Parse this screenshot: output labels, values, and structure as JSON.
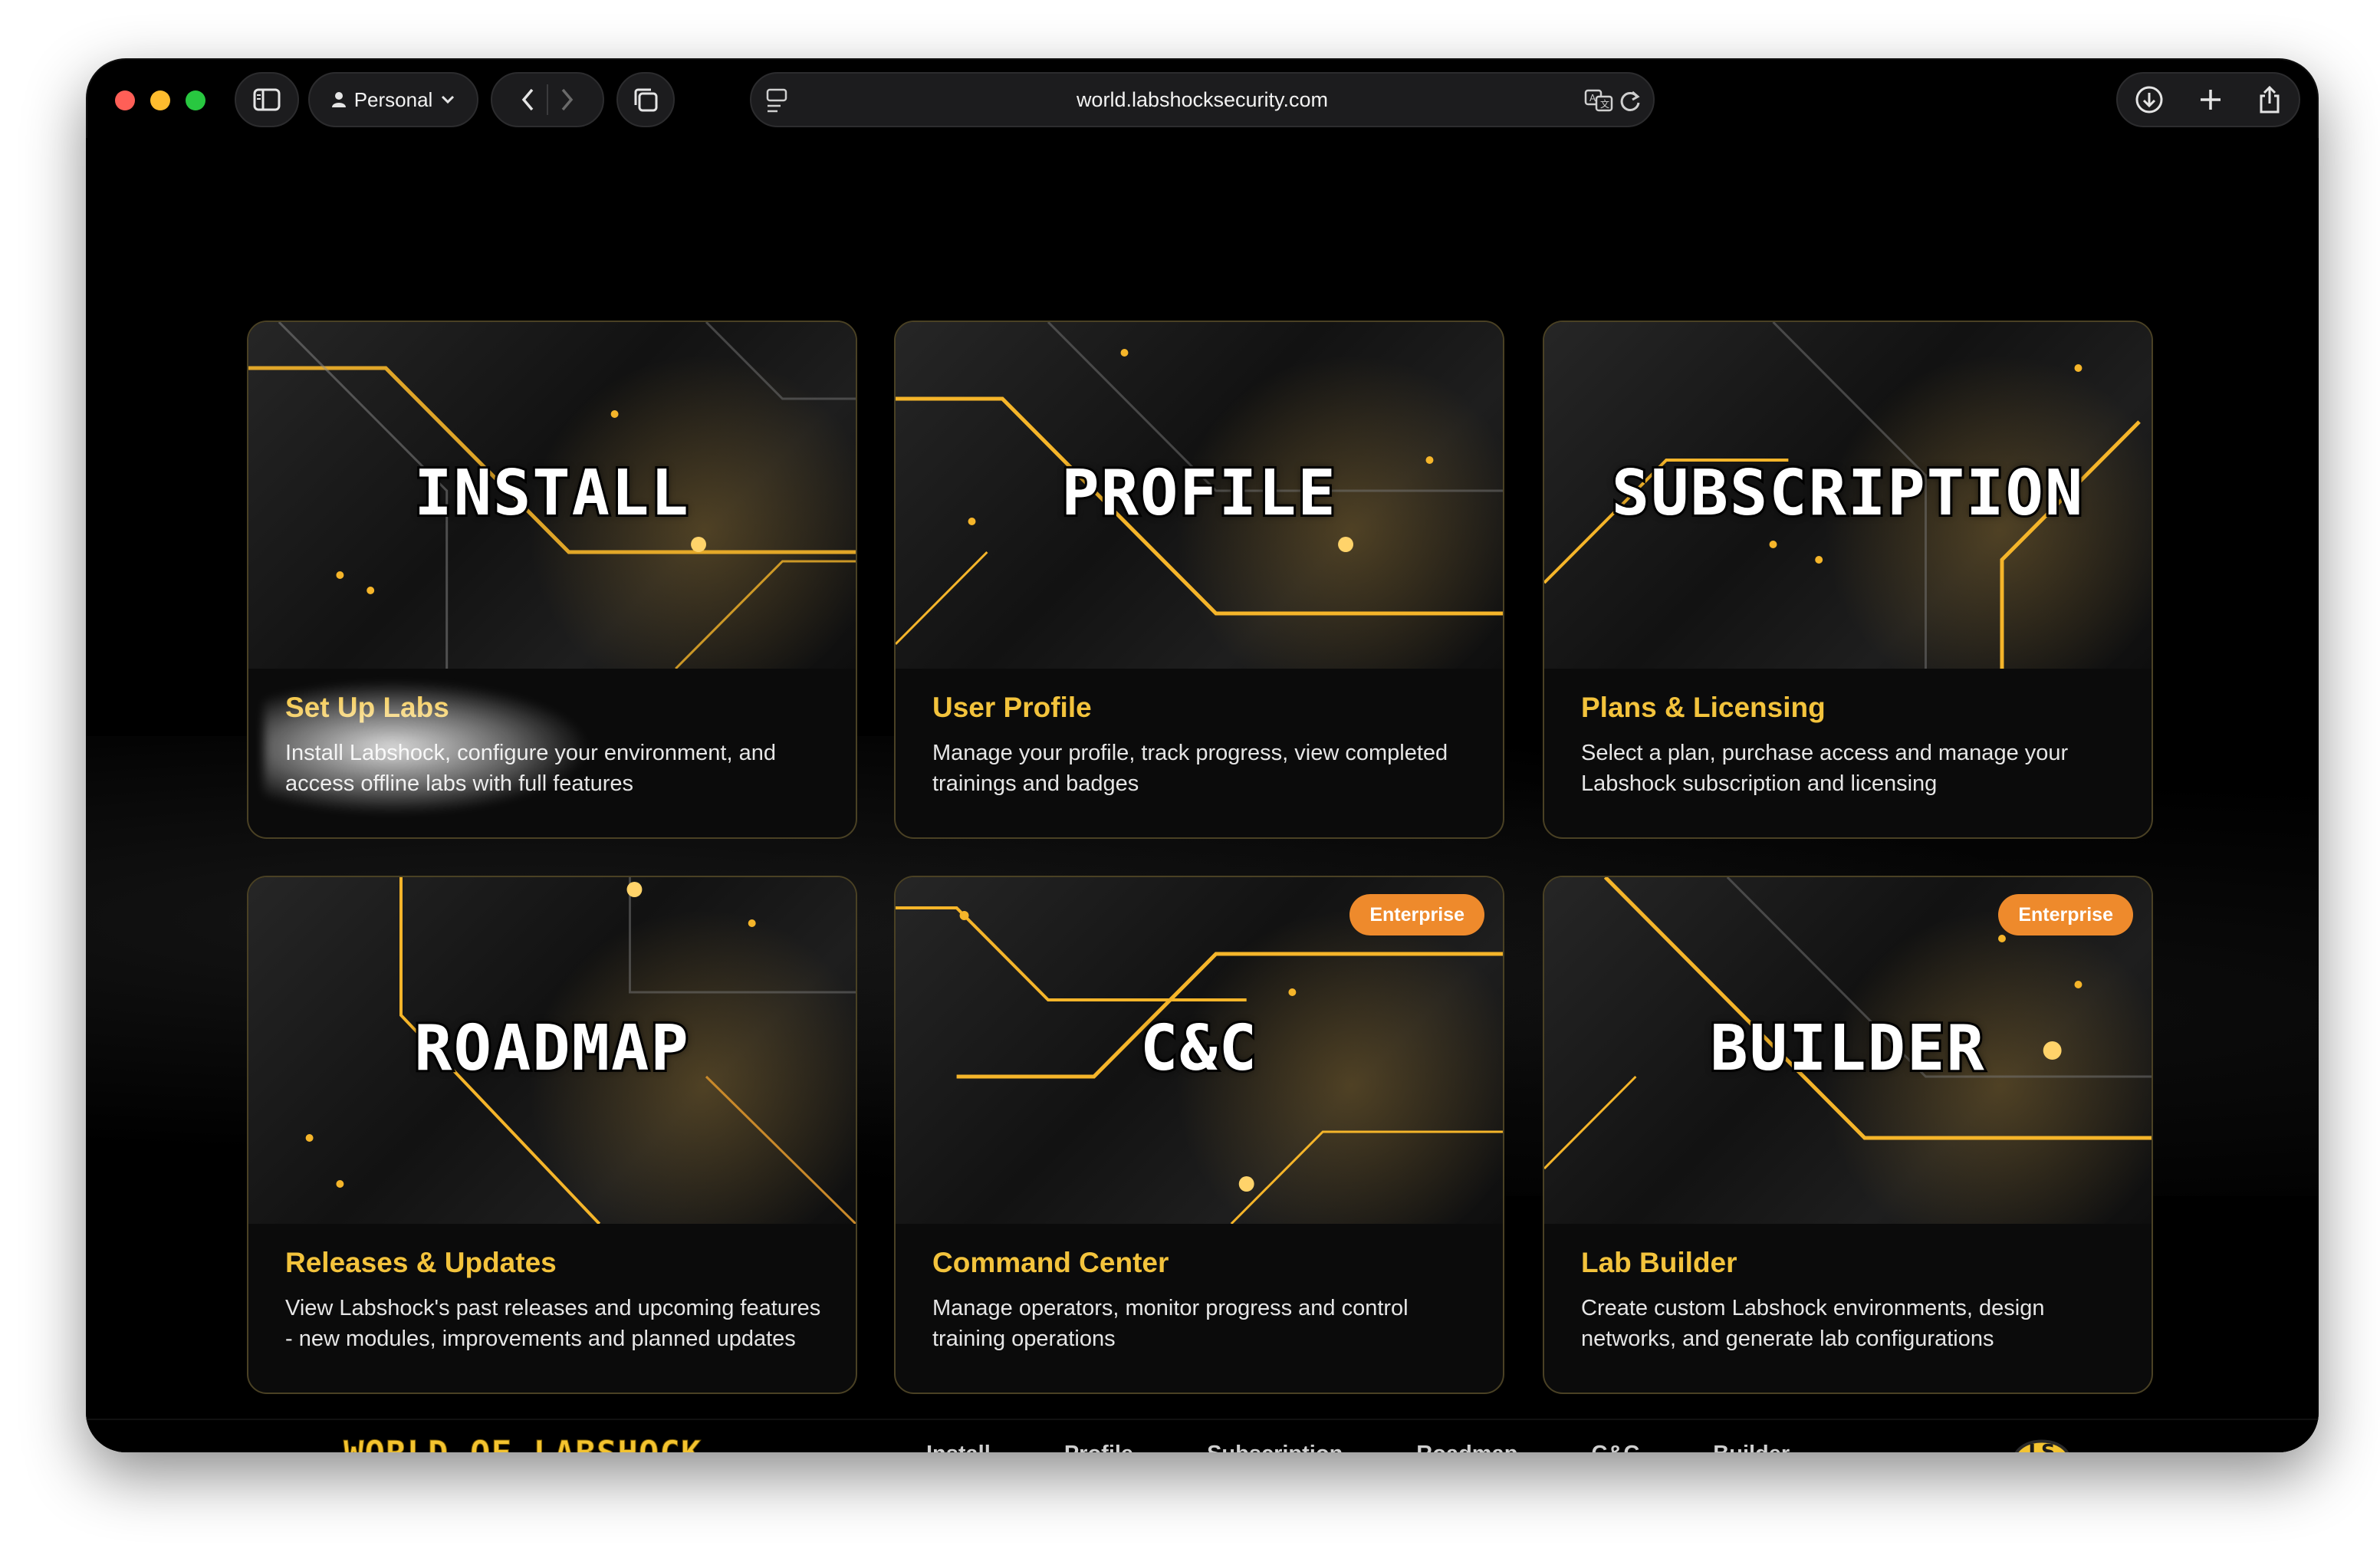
{
  "browser": {
    "profile_label": "Personal",
    "url": "world.labshocksecurity.com"
  },
  "cards": [
    {
      "title": "INSTALL",
      "subtitle": "Set Up Labs",
      "description": "Install Labshock, configure your environment, and access offline labs with full features",
      "badge": ""
    },
    {
      "title": "PROFILE",
      "subtitle": "User Profile",
      "description": "Manage your profile, track progress, view completed trainings and badges",
      "badge": ""
    },
    {
      "title": "SUBSCRIPTION",
      "subtitle": "Plans & Licensing",
      "description": "Select a plan, purchase access and manage your Labshock subscription and licensing",
      "badge": ""
    },
    {
      "title": "ROADMAP",
      "subtitle": "Releases & Updates",
      "description": "View Labshock's past releases and upcoming features - new modules, improvements and planned updates",
      "badge": ""
    },
    {
      "title": "C&C",
      "subtitle": "Command Center",
      "description": "Manage operators, monitor progress and control training operations",
      "badge": "Enterprise"
    },
    {
      "title": "BUILDER",
      "subtitle": "Lab Builder",
      "description": "Create custom Labshock environments, design networks, and generate lab configurations",
      "badge": "Enterprise"
    }
  ],
  "footer": {
    "logo_text": "WORLD OF LABSHOCK",
    "nav": [
      "Install",
      "Profile",
      "Subscription",
      "Roadmap",
      "C&C",
      "Builder"
    ],
    "badge_logo_text": "LS"
  },
  "colors": {
    "accent": "#f3c33c",
    "badge": "#ee8a2c",
    "background": "#000000"
  }
}
